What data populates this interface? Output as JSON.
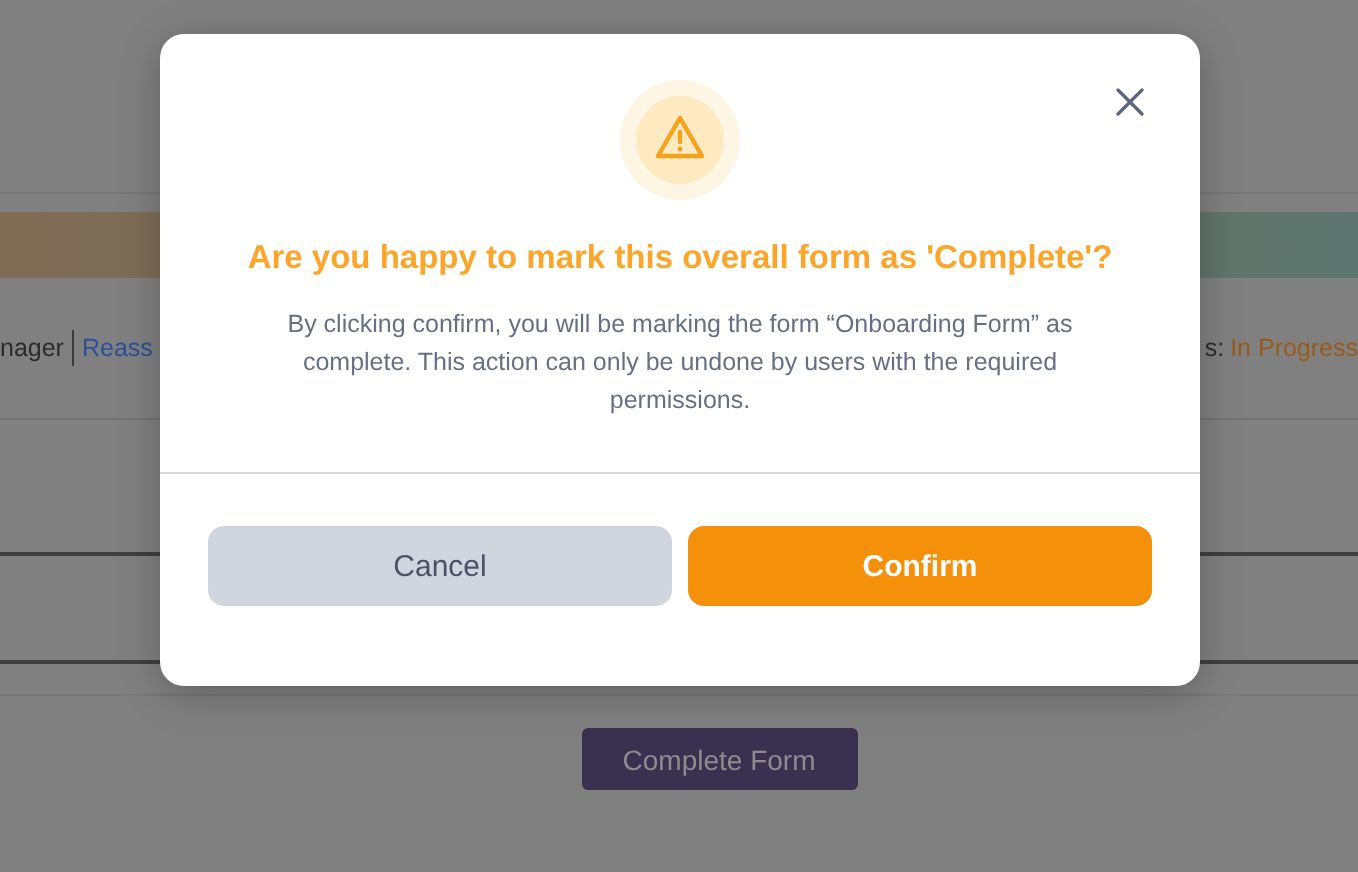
{
  "background": {
    "left_text": "nager",
    "left_link": "Reass",
    "right_label": "s:",
    "right_status": "In Progress",
    "button": "Complete Form"
  },
  "dialog": {
    "title": "Are you happy to mark this overall form as 'Complete'?",
    "message": "By clicking confirm, you will be marking the form “Onboarding Form” as complete. This action can only be undone by users with the required permissions.",
    "buttons": [
      {
        "label": "Cancel",
        "kind": "secondary"
      },
      {
        "label": "Confirm",
        "kind": "primary"
      }
    ]
  }
}
